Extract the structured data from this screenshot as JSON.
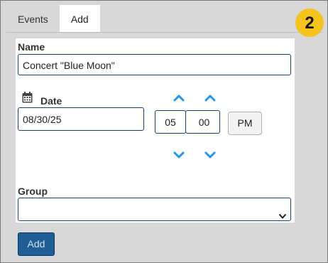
{
  "tabs": [
    {
      "label": "Events",
      "active": false
    },
    {
      "label": "Add",
      "active": true
    }
  ],
  "step_badge": "2",
  "form": {
    "name_label": "Name",
    "name_value": "Concert \"Blue Moon\"",
    "date_label": "Date",
    "date_value": "08/30/25",
    "hour_value": "05",
    "time_separator": ":",
    "minute_value": "00",
    "ampm_label": "PM",
    "group_label": "Group",
    "group_value": ""
  },
  "submit_label": "Add",
  "colors": {
    "accent": "#2196f3",
    "badge": "#f5c31c",
    "submit": "#1f5d95",
    "field_border": "#13427a"
  },
  "icons": [
    "calendar-icon",
    "chevron-up-icon",
    "chevron-down-icon",
    "select-caret-icon"
  ]
}
